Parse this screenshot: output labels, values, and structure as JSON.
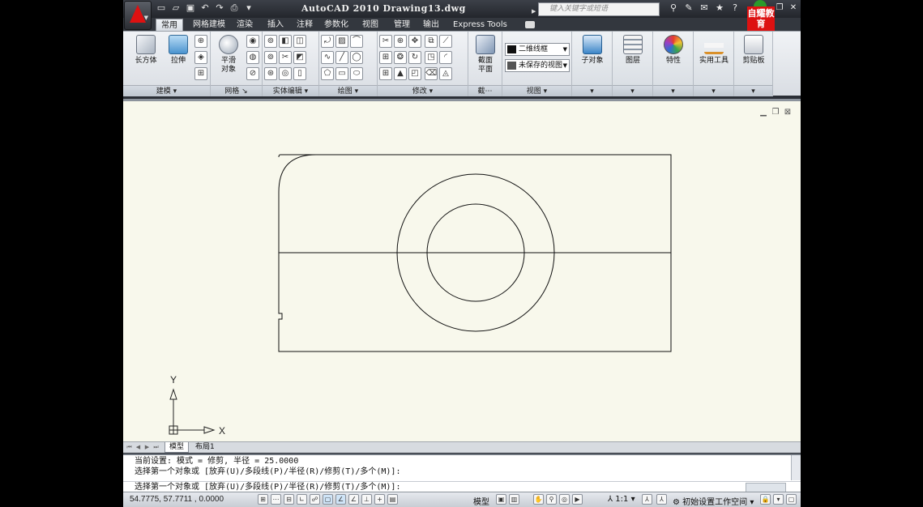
{
  "titlebar": {
    "title": "AutoCAD 2010   Drawing13.dwg",
    "search_placeholder": "键入关键字或短语",
    "badge_text": "自耀教育"
  },
  "tabs": [
    "常用",
    "网格建模",
    "渲染",
    "插入",
    "注释",
    "参数化",
    "视图",
    "管理",
    "输出",
    "Express Tools"
  ],
  "ribbon": {
    "panels": {
      "modeling": "建模",
      "mesh": "网格",
      "solid_edit": "实体编辑",
      "draw": "绘图",
      "modify": "修改",
      "section": "截⋯",
      "view": "视图"
    },
    "buttons": {
      "box": "长方体",
      "extrude": "拉伸",
      "smooth": "平滑\n对象",
      "section_plane": "截面\n平面",
      "subobject": "子对象",
      "layers": "图层",
      "properties": "特性",
      "utilities": "实用工具",
      "clipboard": "剪贴板"
    },
    "view_combos": {
      "visual_style": "二维线框",
      "saved_view": "未保存的视图"
    }
  },
  "layout_tabs": [
    "模型",
    "布局1"
  ],
  "command": {
    "history": [
      "当前设置: 模式 = 修剪, 半径 = 25.0000",
      "选择第一个对象或 [放弃(U)/多段线(P)/半径(R)/修剪(T)/多个(M)]:"
    ],
    "input": "选择第一个对象或 [放弃(U)/多段线(P)/半径(R)/修剪(T)/多个(M)]:"
  },
  "status": {
    "coords": "54.7775,  57.7711 , 0.0000",
    "model_label": "模型",
    "scale": "1:1",
    "workspace": "初始设置工作空间"
  },
  "ucs": {
    "x_label": "X",
    "y_label": "Y"
  },
  "colors": {
    "canvas": "#f8f8ec",
    "ribbon": "#e6e9ee",
    "title_bar": "#2b2f36",
    "logo_red": "#dd1111"
  }
}
